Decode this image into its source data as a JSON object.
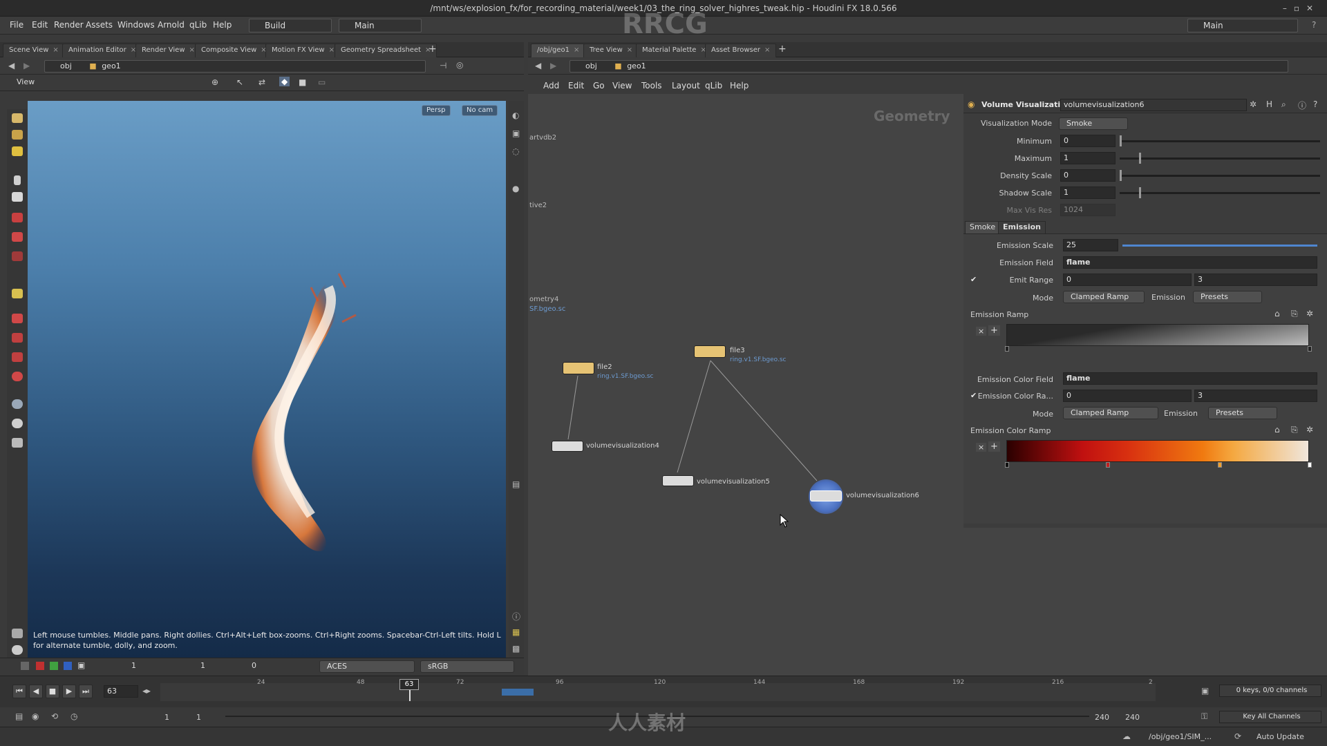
{
  "window_title": "/mnt/ws/explosion_fx/for_recording_material/week1/03_the_ring_solver_highres_tweak.hip - Houdini FX 18.0.566",
  "menu": {
    "items": [
      "File",
      "Edit",
      "Render",
      "Assets",
      "Windows",
      "Arnold",
      "qLib",
      "Help"
    ],
    "build": "Build",
    "main": "Main",
    "right_main": "Main"
  },
  "left_tabs": [
    "Scene View",
    "Animation Editor",
    "Render View",
    "Composite View",
    "Motion FX View",
    "Geometry Spreadsheet"
  ],
  "right_tabs": [
    "/obj/geo1",
    "Tree View",
    "Material Palette",
    "Asset Browser"
  ],
  "left_path": {
    "obj": "obj",
    "geo": "geo1"
  },
  "right_path": {
    "obj": "obj",
    "geo": "geo1"
  },
  "viewport": {
    "label": "View",
    "persp": "Persp",
    "cam": "No cam",
    "help": "Left mouse tumbles. Middle pans. Right dollies. Ctrl+Alt+Left box-zooms. Ctrl+Right zooms. Spacebar-Ctrl-Left tilts. Hold L for alternate tumble, dolly, and zoom."
  },
  "vp_bottom": {
    "val1": "1",
    "val2": "1",
    "val3": "0",
    "ocio": "ACES",
    "display": "sRGB"
  },
  "network_menu": [
    "Add",
    "Edit",
    "Go",
    "View",
    "Tools",
    "Layout",
    "qLib",
    "Help"
  ],
  "network": {
    "context": "Geometry",
    "ghosts": [
      "artvdb2",
      "tive2",
      "ometry4",
      "SF.bgeo.sc"
    ],
    "nodes": [
      {
        "name": "file2",
        "sub": "ring.v1.SF.bgeo.sc"
      },
      {
        "name": "file3",
        "sub": "ring.v1.SF.bgeo.sc"
      },
      {
        "name": "volumevisualization4",
        "sub": ""
      },
      {
        "name": "volumevisualization5",
        "sub": ""
      },
      {
        "name": "volumevisualization6",
        "sub": ""
      }
    ]
  },
  "params": {
    "node_type": "Volume Visualization",
    "node_name": "volumevisualization6",
    "vis_mode_label": "Visualization Mode",
    "vis_mode": "Smoke",
    "minimum_label": "Minimum",
    "minimum": "0",
    "maximum_label": "Maximum",
    "maximum": "1",
    "density_label": "Density Scale",
    "density": "0",
    "shadow_label": "Shadow Scale",
    "shadow": "1",
    "maxres_label": "Max Vis Res",
    "maxres": "1024",
    "tabs": [
      "Smoke",
      "Emission"
    ],
    "emission_scale_label": "Emission Scale",
    "emission_scale": "25",
    "emission_field_label": "Emission Field",
    "emission_field": "flame",
    "emit_range_label": "Emit Range",
    "emit_range_min": "0",
    "emit_range_max": "3",
    "mode_label": "Mode",
    "mode": "Clamped Ramp",
    "emission_lbl": "Emission",
    "presets": "Presets",
    "emission_ramp_label": "Emission Ramp",
    "color_field_label": "Emission Color Field",
    "color_field": "flame",
    "color_range_label": "Emission Color Ra...",
    "color_range_min": "0",
    "color_range_max": "3",
    "mode2": "Clamped Ramp",
    "presets2": "Presets",
    "color_ramp_label": "Emission Color Ramp"
  },
  "timeline": {
    "frame": "63",
    "ticks": [
      "24",
      "48",
      "72",
      "96",
      "120",
      "144",
      "168",
      "192",
      "216",
      "2"
    ],
    "marker": "63",
    "start": "1",
    "start2": "1",
    "end": "240",
    "end2": "240",
    "keys": "0 keys, 0/0 channels",
    "key_all": "Key All Channels"
  },
  "status": {
    "path": "/obj/geo1/SIM_...",
    "update": "Auto Update"
  },
  "watermark": [
    "RRCG",
    "人人素材"
  ],
  "colors": {
    "accent": "#3b6ea8",
    "node_file": "#e0c070",
    "node_vis": "#d8d8d8",
    "selected": "#5c8fe0"
  }
}
